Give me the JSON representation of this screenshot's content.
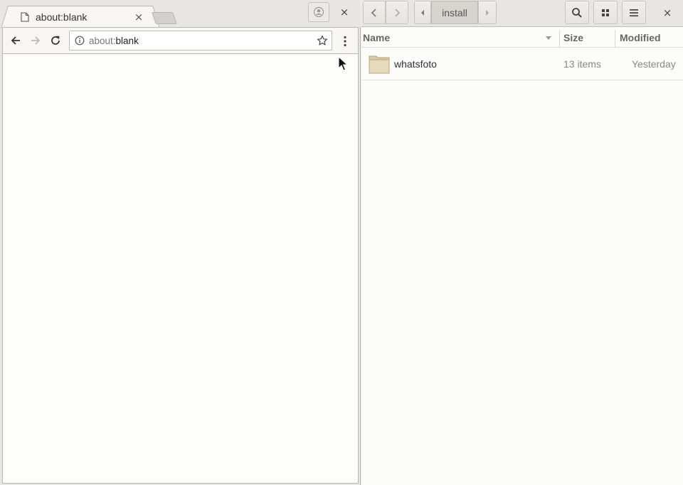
{
  "browser": {
    "tab": {
      "title": "about:blank",
      "close_glyph": "×"
    },
    "window_close_glyph": "×",
    "omnibox": {
      "scheme": "about:",
      "rest": "blank"
    },
    "icons": [
      "page-icon",
      "profile-icon",
      "back-icon",
      "forward-icon",
      "reload-icon",
      "info-icon",
      "star-icon",
      "menu-icon"
    ]
  },
  "files": {
    "path": {
      "current": "install"
    },
    "window_close_glyph": "×",
    "columns": {
      "name": "Name",
      "size": "Size",
      "modified": "Modified"
    },
    "rows": [
      {
        "name": "whatsfoto",
        "size": "13 items",
        "modified": "Yesterday",
        "icon": "folder-icon"
      }
    ],
    "icons": [
      "back-icon",
      "forward-icon",
      "path-left-icon",
      "path-right-icon",
      "search-icon",
      "grid-view-icon",
      "hamburger-menu-icon",
      "sort-arrow-icon"
    ]
  }
}
